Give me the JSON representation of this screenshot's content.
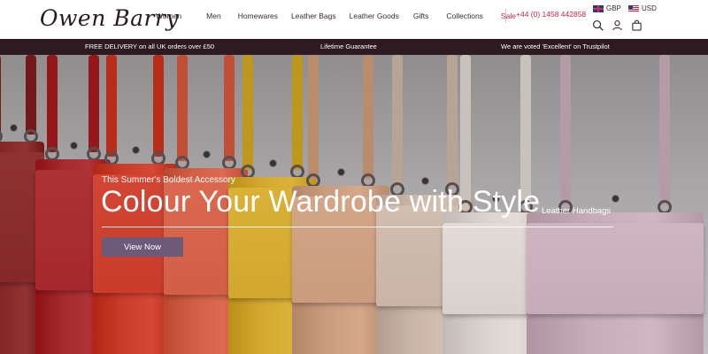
{
  "brand": {
    "logo_text": "Owen Barry"
  },
  "nav": {
    "items": [
      {
        "label": "Women"
      },
      {
        "label": "Men"
      },
      {
        "label": "Homewares"
      },
      {
        "label": "Leather Bags"
      },
      {
        "label": "Leather Goods"
      },
      {
        "label": "Gifts"
      },
      {
        "label": "Collections"
      },
      {
        "label": "Sale"
      }
    ],
    "sale_color": "#c8254a"
  },
  "contact": {
    "phone": "+44 (0) 1458 442858"
  },
  "currency": {
    "options": [
      {
        "code": "GBP",
        "flag": "uk-flag"
      },
      {
        "code": "USD",
        "flag": "us-flag"
      }
    ]
  },
  "header_icons": [
    "search-icon",
    "account-icon",
    "basket-icon"
  ],
  "promo_bar": {
    "background": "#2e1a21",
    "messages": [
      "FREE DELIVERY on all UK orders over £50",
      "Lifetime Guarantee",
      "We are voted 'Excellent' on Trustpilot"
    ]
  },
  "hero": {
    "kicker": "This Summer's Boldest Accessory",
    "headline": "Colour Your Wardrobe with Style",
    "category": "Leather Handbags",
    "cta_label": "View Now",
    "cta_color": "#6c5a78",
    "bag_colors": [
      "#8e2a2c",
      "#b02a2e",
      "#d8402c",
      "#e0664a",
      "#e0b430",
      "#d9a888",
      "#d7c2b2",
      "#e8e2dc",
      "#d4b8c6"
    ]
  }
}
